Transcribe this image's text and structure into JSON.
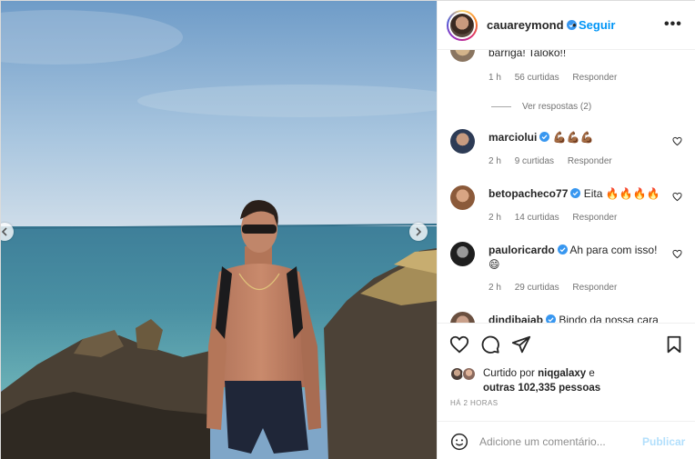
{
  "header": {
    "username": "cauareymond",
    "separator": "•",
    "follow_label": "Seguir",
    "more_label": "•••"
  },
  "comments": [
    {
      "username": "",
      "text": "barriga! Taloko!!",
      "time": "1 h",
      "likes": "56 curtidas",
      "reply_label": "Responder",
      "view_replies": "Ver respostas (2)"
    },
    {
      "username": "marciolui",
      "text": "💪🏾💪🏾💪🏾",
      "time": "2 h",
      "likes": "9 curtidas",
      "reply_label": "Responder"
    },
    {
      "username": "betopacheco77",
      "text": "Eita 🔥🔥🔥🔥",
      "time": "2 h",
      "likes": "14 curtidas",
      "reply_label": "Responder"
    },
    {
      "username": "pauloricardo",
      "text": "Ah para com isso!",
      "text_line2": "😄",
      "time": "2 h",
      "likes": "29 curtidas",
      "reply_label": "Responder"
    },
    {
      "username": "dindibaiab",
      "text": "Bindo da nossa cara"
    }
  ],
  "likes": {
    "prefix": "Curtido por",
    "liker": "niqgalaxy",
    "connector": "e",
    "others": "outras 102,335 pessoas",
    "time_ago": "HÁ 2 HORAS"
  },
  "add_comment": {
    "placeholder": "Adicione um comentário...",
    "publish_label": "Publicar"
  },
  "icons": {
    "verified": "verified-badge-icon",
    "like": "heart-icon",
    "comment": "comment-icon",
    "share": "paper-plane-icon",
    "save": "bookmark-icon",
    "emoji": "smiley-icon",
    "prev": "chevron-left-icon",
    "next": "chevron-right-icon"
  },
  "colors": {
    "link_blue": "#0095f6",
    "verified_blue": "#3897f0",
    "publish_disabled": "#b2dffc",
    "muted_text": "#737373"
  }
}
